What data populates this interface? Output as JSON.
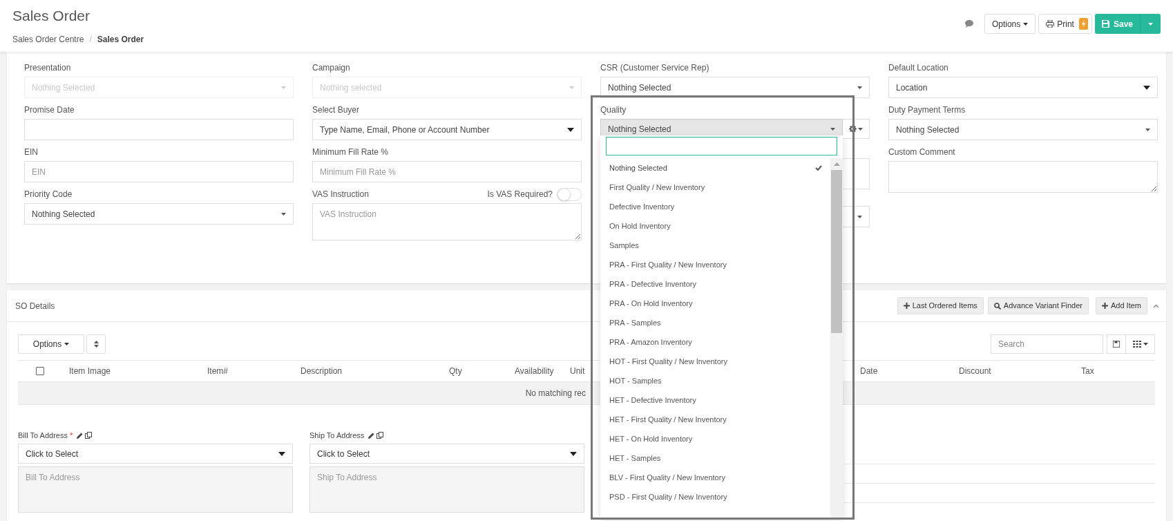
{
  "header": {
    "title": "Sales Order",
    "breadcrumb": [
      {
        "label": "Sales Order Centre",
        "current": false
      },
      {
        "label": "Sales Order",
        "current": true
      }
    ],
    "breadcrumb_separator": "/",
    "options_button": "Options",
    "print_button": "Print",
    "save_button": "Save"
  },
  "form": {
    "columns": [
      [
        {
          "label": "Presentation",
          "kind": "select",
          "value": "Nothing Selected",
          "disabled": true
        },
        {
          "label": "Promise Date",
          "kind": "input"
        },
        {
          "label": "EIN",
          "kind": "input",
          "placeholder": "EIN"
        },
        {
          "label": "Priority Code",
          "kind": "select",
          "value": "Nothing Selected",
          "disabled": false
        }
      ],
      [
        {
          "label": "Campaign",
          "kind": "select",
          "value": "Nothing selected",
          "disabled": true
        },
        {
          "label": "Select Buyer",
          "kind": "select",
          "value": "Type Name, Email, Phone or Account Number",
          "disabled": false
        },
        {
          "label": "Minimum Fill Rate %",
          "kind": "input",
          "placeholder": "Minimum Fill Rate %"
        },
        {
          "label": "VAS Instruction",
          "kind": "textarea",
          "placeholder": "VAS Instruction",
          "toggle": {
            "label": "Is VAS Required?",
            "on": false
          }
        }
      ],
      [
        {
          "label": "CSR (Customer Service Rep)",
          "kind": "select",
          "value": "Nothing Selected",
          "disabled": false
        },
        {
          "label": "Quality",
          "kind": "quality",
          "value": "Nothing Selected",
          "open": true
        },
        {
          "kind": "covered-textarea"
        },
        {
          "kind": "covered-select"
        }
      ],
      [
        {
          "label": "Default Location",
          "kind": "select",
          "value": "Location",
          "disabled": false
        },
        {
          "label": "Duty Payment Terms",
          "kind": "select",
          "value": "Nothing Selected",
          "disabled": false
        },
        {
          "label": "Custom Comment",
          "kind": "textarea"
        }
      ]
    ]
  },
  "quality_dropdown": {
    "options": [
      {
        "label": "Nothing Selected",
        "selected": true
      },
      {
        "label": "First Quality / New Inventory",
        "selected": false
      },
      {
        "label": "Defective Inventory",
        "selected": false
      },
      {
        "label": "On Hold Inventory",
        "selected": false
      },
      {
        "label": "Samples",
        "selected": false
      },
      {
        "label": "PRA - First Quality / New Inventory",
        "selected": false
      },
      {
        "label": "PRA - Defective Inventory",
        "selected": false
      },
      {
        "label": "PRA - On Hold Inventory",
        "selected": false
      },
      {
        "label": "PRA - Samples",
        "selected": false
      },
      {
        "label": "PRA - Amazon Inventory",
        "selected": false
      },
      {
        "label": "HOT - First Quality / New Inventory",
        "selected": false
      },
      {
        "label": "HOT - Samples",
        "selected": false
      },
      {
        "label": "HET - Defective Inventory",
        "selected": false
      },
      {
        "label": "HET - First Quality / New Inventory",
        "selected": false
      },
      {
        "label": "HET - On Hold Inventory",
        "selected": false
      },
      {
        "label": "HET - Samples",
        "selected": false
      },
      {
        "label": "BLV - First Quality / New Inventory",
        "selected": false
      },
      {
        "label": "PSD - First Quality / New Inventory",
        "selected": false
      }
    ]
  },
  "so_details": {
    "title": "SO Details",
    "buttons": [
      {
        "label": "Last Ordered Items",
        "kind": "add"
      },
      {
        "label": "Advance Variant Finder",
        "kind": "find"
      },
      {
        "label": "Add Item",
        "kind": "add"
      }
    ],
    "options_button": "Options",
    "search": {
      "placeholder": "Search"
    },
    "table": {
      "select_all_checked": false,
      "columns": [
        "Item Image",
        "Item#",
        "Description",
        "Qty",
        "Availability",
        "Unit",
        "Date",
        "Discount",
        "Tax"
      ],
      "empty_message": "No matching rec"
    }
  },
  "addresses": [
    {
      "label": "Bill To Address",
      "required_mark": "*",
      "select": "Click to Select",
      "placeholder": "Bill To Address"
    },
    {
      "label": "Ship To Address",
      "select": "Click to Select",
      "placeholder": "Ship To Address"
    }
  ]
}
